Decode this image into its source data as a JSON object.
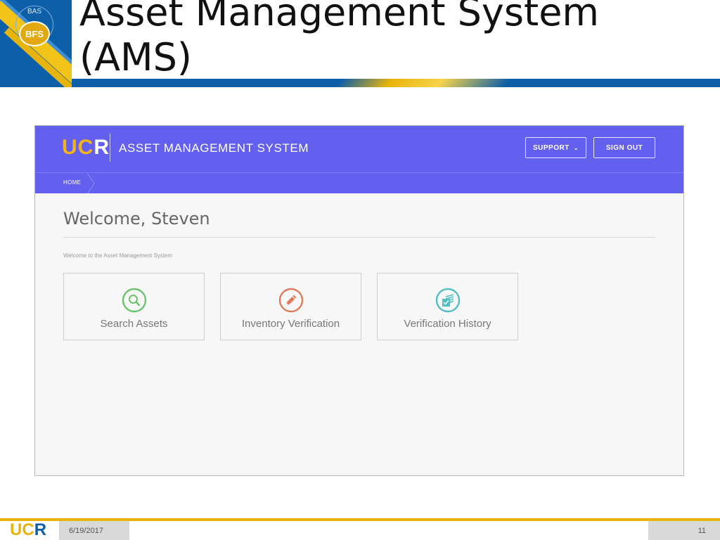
{
  "slide": {
    "logo_top": "BAS",
    "logo_badge": "BFS",
    "title_line1": "Asset Management System",
    "title_line2": "(AMS)"
  },
  "app": {
    "logo_u": "U",
    "logo_c": "C",
    "logo_r": "R",
    "title": "ASSET MANAGEMENT SYSTEM",
    "support_label": "SUPPORT",
    "support_chevron": "⌄",
    "signout_label": "SIGN OUT",
    "breadcrumb_home": "HOME",
    "welcome": "Welcome, Steven",
    "welcome_sub": "Welcome to the Asset Management System",
    "tiles": [
      {
        "label": "Search Assets",
        "icon": "search-icon",
        "color": "#6cc36f"
      },
      {
        "label": "Inventory Verification",
        "icon": "pencil-icon",
        "color": "#e07a5c"
      },
      {
        "label": "Verification History",
        "icon": "history-icon",
        "color": "#4fbfc2"
      }
    ],
    "colors": {
      "topbar": "#6360ef",
      "logo_gold": "#f2b31d"
    }
  },
  "footer": {
    "logo_u": "U",
    "logo_c": "C",
    "logo_r": "R",
    "date": "6/19/2017",
    "page": "11"
  }
}
